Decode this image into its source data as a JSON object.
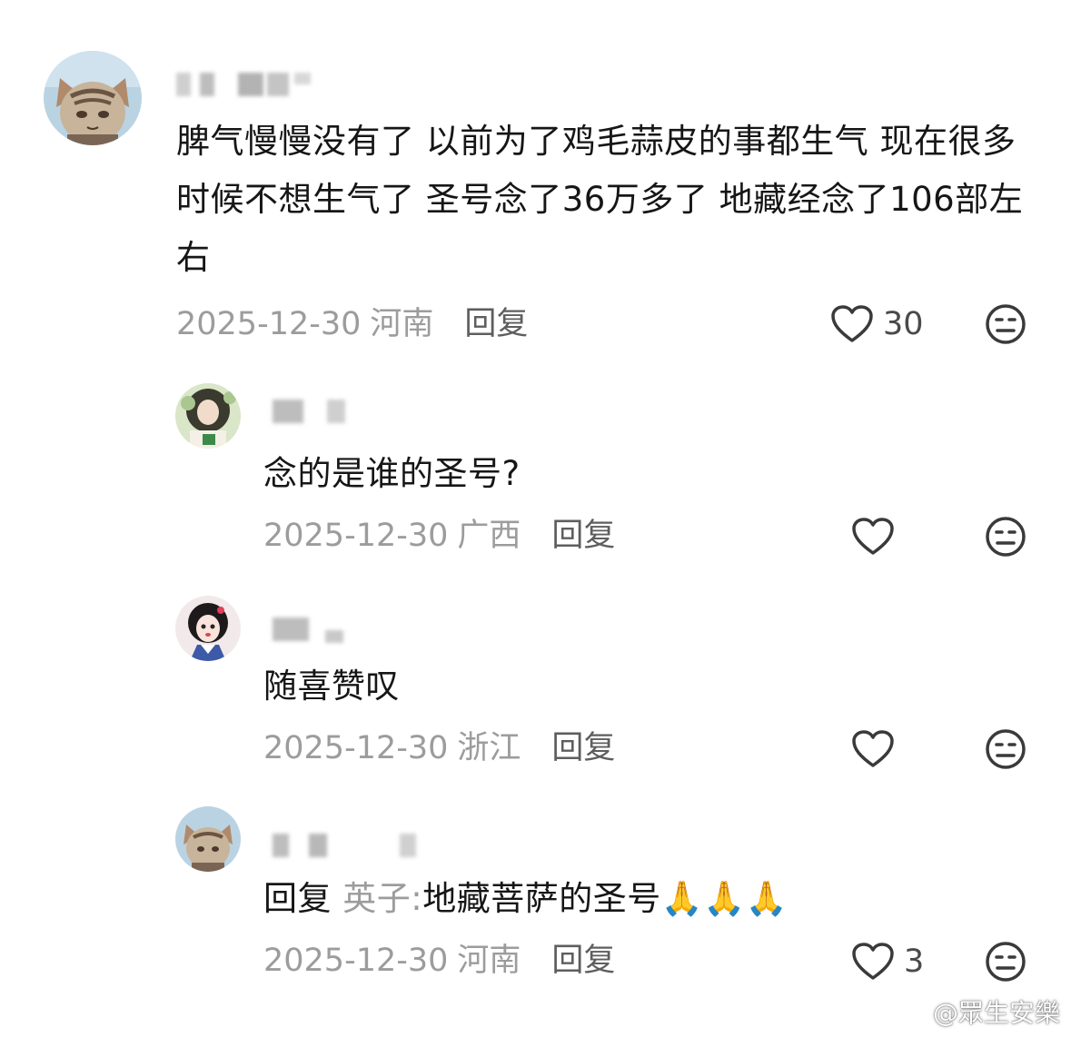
{
  "comments": [
    {
      "text": "脾气慢慢没有了  以前为了鸡毛蒜皮的事都生气  现在很多时候不想生气了  圣号念了36万多了  地藏经念了106部左右",
      "date": "2025-12-30",
      "region": "河南",
      "reply_label": "回复",
      "like_count": "30",
      "avatar": "cat-avatar"
    },
    {
      "text": "念的是谁的圣号?",
      "date": "2025-12-30",
      "region": "广西",
      "reply_label": "回复",
      "like_count": "",
      "avatar": "girl-green-avatar"
    },
    {
      "text": "随喜赞叹",
      "date": "2025-12-30",
      "region": "浙江",
      "reply_label": "回复",
      "like_count": "",
      "avatar": "girl-cartoon-avatar"
    },
    {
      "reply_prefix": "回复",
      "reply_target": "英子:",
      "text": "地藏菩萨的圣号🙏🙏🙏",
      "date": "2025-12-30",
      "region": "河南",
      "reply_label": "回复",
      "like_count": "3",
      "avatar": "cat-avatar"
    }
  ],
  "watermark": "@眾生安樂",
  "icons": {
    "like": "heart-outline-icon",
    "dislike": "meh-face-icon",
    "weibo": "weibo-logo-icon"
  },
  "colors": {
    "text": "#161616",
    "meta": "#9c9c9c",
    "reply": "#5e5e5e"
  }
}
